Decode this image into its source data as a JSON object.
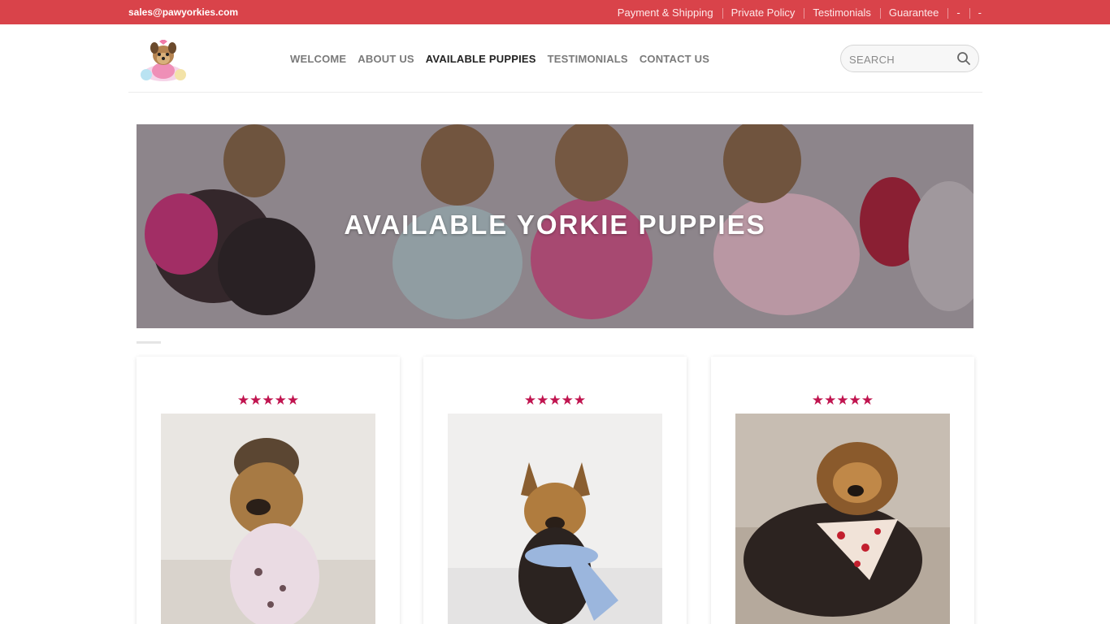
{
  "topbar": {
    "email": "sales@pawyorkies.com",
    "links": [
      "Payment & Shipping",
      "Private Policy",
      "Testimonials",
      "Guarantee",
      "-",
      "-"
    ]
  },
  "header": {
    "nav": [
      "WELCOME",
      "ABOUT US",
      "AVAILABLE PUPPIES",
      "TESTIMONIALS",
      "CONTACT US"
    ],
    "active_nav": "AVAILABLE PUPPIES",
    "search_placeholder": "SEARCH"
  },
  "hero": {
    "title": "AVAILABLE YORKIE PUPPIES"
  },
  "products": [
    {
      "rating": 5,
      "stars": "★★★★★"
    },
    {
      "rating": 5,
      "stars": "★★★★★"
    },
    {
      "rating": 5,
      "stars": "★★★★★"
    }
  ],
  "icons": {
    "search": "search-icon",
    "logo": "yorkie-logo"
  },
  "colors": {
    "topbar": "#d9434a",
    "stars": "#c0144f",
    "nav_active": "#222222",
    "nav": "#7a7a7a"
  }
}
